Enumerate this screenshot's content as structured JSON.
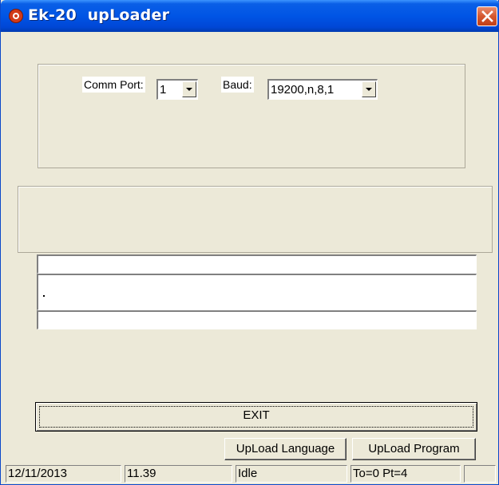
{
  "window": {
    "title": "Ek-20  upLoader",
    "close_icon": "close-icon",
    "app_icon": "app-icon"
  },
  "settings": {
    "comm_port_label": "Comm Port:",
    "comm_port_value": "1",
    "baud_label": "Baud:",
    "baud_value": "19200,n,8,1"
  },
  "fields": {
    "line1": "",
    "line2": "",
    "line3": ""
  },
  "buttons": {
    "exit": "EXIT",
    "upload_language": "UpLoad Language",
    "upload_program": "UpLoad Program"
  },
  "status": {
    "date": "12/11/2013",
    "time": "11.39",
    "state": "Idle",
    "info": "To=0 Pt=4",
    "extra": ""
  },
  "colors": {
    "titlebar": "#0055e5",
    "close_button": "#d4572f",
    "window_bg": "#ece9d8"
  }
}
